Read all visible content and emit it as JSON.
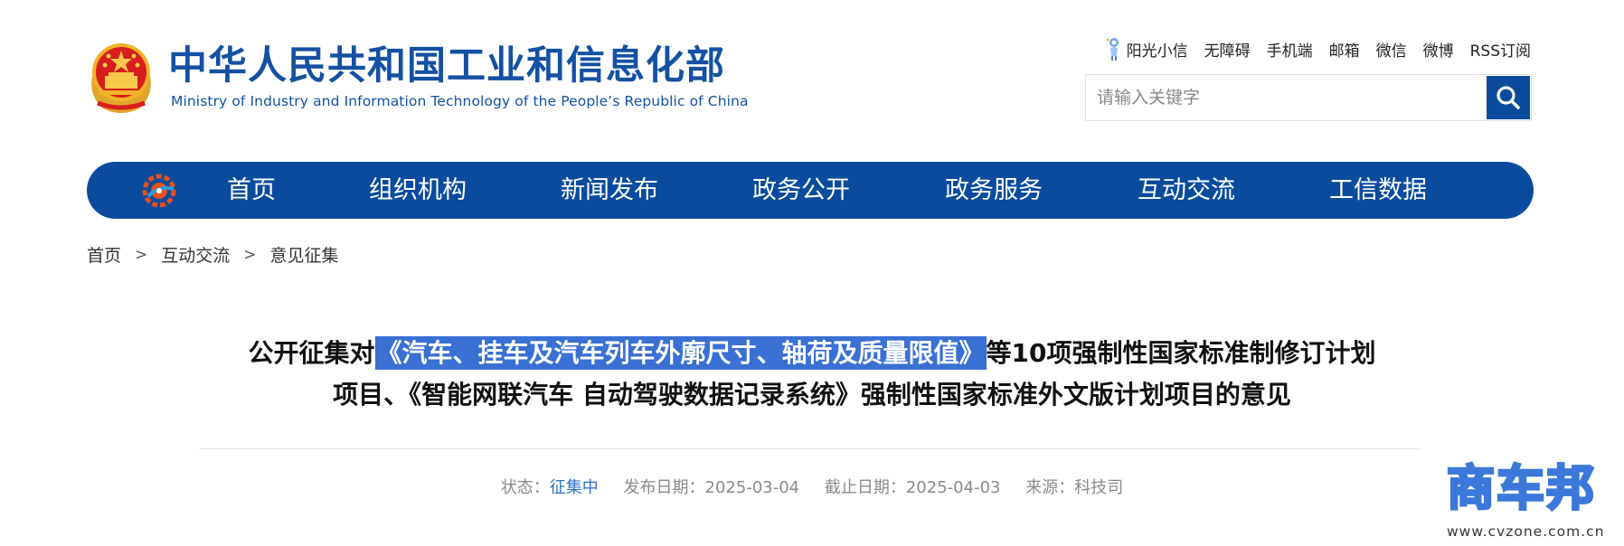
{
  "header": {
    "title_cn": "中华人民共和国工业和信息化部",
    "title_en": "Ministry of Industry and Information Technology of the People’s Republic of China",
    "emblem_icon": "national-emblem-icon"
  },
  "top_links": {
    "sunshine": "阳光小信",
    "accessibility": "无障碍",
    "mobile": "手机端",
    "mail": "邮箱",
    "wechat": "微信",
    "weibo": "微博",
    "rss": "RSS订阅"
  },
  "search": {
    "placeholder": "请输入关键字",
    "icon": "search-icon"
  },
  "nav": {
    "items": [
      "首页",
      "组织机构",
      "新闻发布",
      "政务公开",
      "政务服务",
      "互动交流",
      "工信数据"
    ]
  },
  "breadcrumb": {
    "items": [
      "首页",
      "互动交流",
      "意见征集"
    ],
    "separator": ">"
  },
  "article": {
    "title_part1": "公开征集对",
    "title_highlight": "《汽车、挂车及汽车列车外廓尺寸、轴荷及质量限值》",
    "title_part2": "等10项强制性国家标准制修订计划",
    "title_line2": "项目、《智能网联汽车 自动驾驶数据记录系统》强制性国家标准外文版计划项目的意见",
    "status_label": "状态：",
    "status_value": "征集中",
    "publish_label": "发布日期：",
    "publish_date": "2025-03-04",
    "deadline_label": "截止日期：",
    "deadline_date": "2025-04-03",
    "source_label": "来源：",
    "source_value": "科技司"
  },
  "watermark": {
    "brand": "商车邦",
    "url": "www.cvzone.com.cn"
  },
  "colors": {
    "brand_blue": "#0b4b9d",
    "title_blue": "#1450a3",
    "highlight": "#3a6fd4",
    "status_blue": "#2f72c4"
  }
}
